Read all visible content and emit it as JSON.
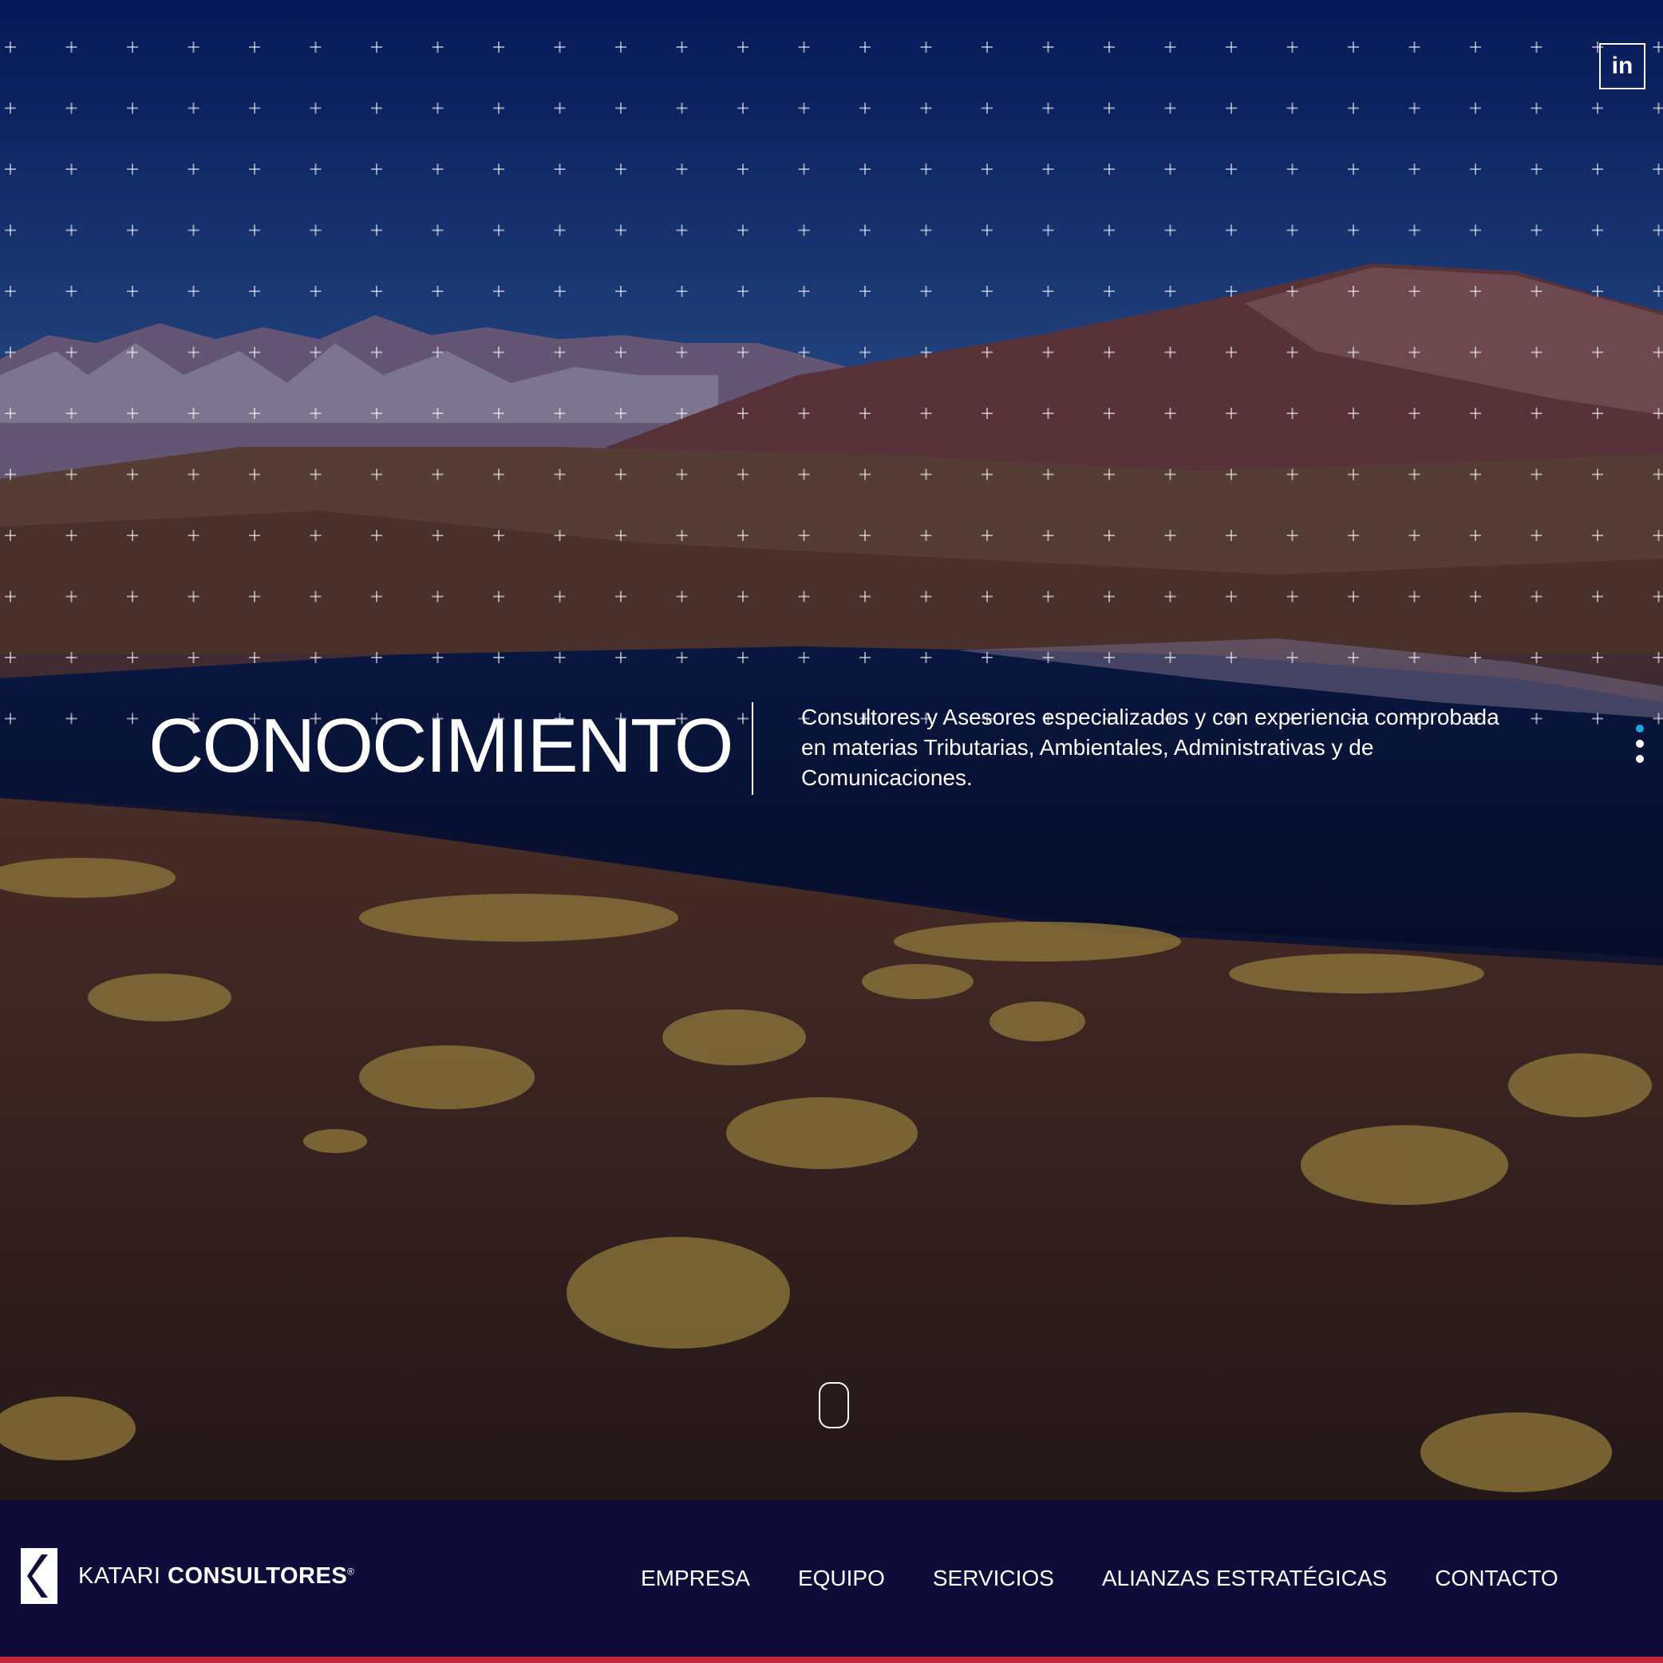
{
  "social": {
    "linkedin_label": "in"
  },
  "hero": {
    "headline": "CONOCIMIENTO",
    "tagline": "Consultores y Asesores especializados y con experiencia comprobada en materias Tributarias, Ambientales, Administrativas y de Comunicaciones.",
    "slides": [
      {
        "active": true
      },
      {
        "active": false
      },
      {
        "active": false
      }
    ]
  },
  "brand": {
    "name_light": "KATARI ",
    "name_bold": "CONSULTORES",
    "registered_mark": "®"
  },
  "nav": {
    "items": [
      "EMPRESA",
      "EQUIPO",
      "SERVICIOS",
      "ALIANZAS ESTRATÉGICAS",
      "CONTACTO"
    ]
  },
  "colors": {
    "navbar_bg": "#0f0c3a",
    "accent_line": "#c0263a",
    "active_dot": "#1ea6e0"
  }
}
